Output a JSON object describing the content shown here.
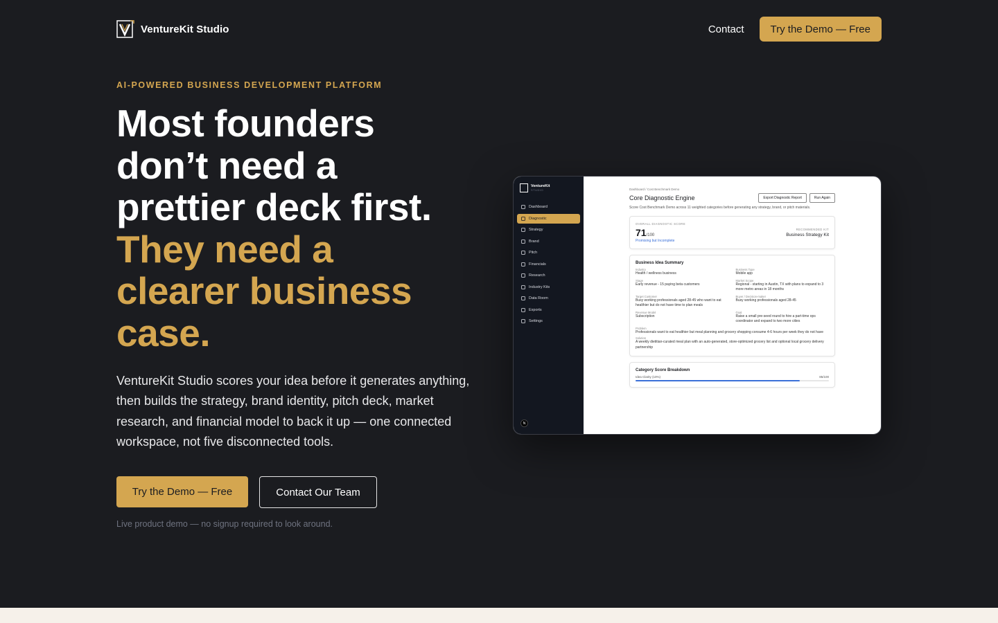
{
  "nav": {
    "brand": "VentureKit Studio",
    "contact": "Contact",
    "cta": "Try the Demo — Free"
  },
  "hero": {
    "eyebrow": "AI-POWERED BUSINESS DEVELOPMENT PLATFORM",
    "headline_white": [
      "Most founders",
      "don’t need a",
      "prettier deck first."
    ],
    "headline_gold": [
      "They need a",
      "clearer business",
      "case."
    ],
    "sub": "VentureKit Studio scores your idea before it generates anything, then builds the strategy, brand identity, pitch deck, market research, and financial model to back it up — one connected workspace, not five disconnected tools.",
    "cta_primary": "Try the Demo — Free",
    "cta_secondary": "Contact Our Team",
    "note": "Live product demo — no signup required to look around."
  },
  "mockup": {
    "brand": "VentureKit",
    "brand_sub": "STUDIO",
    "sidebar": [
      "Dashboard",
      "Diagnostic",
      "Strategy",
      "Brand",
      "Pitch",
      "Financials",
      "Research",
      "Industry Kits",
      "Data Room",
      "Exports",
      "Settings"
    ],
    "active_item": "Diagnostic",
    "avatar": "N",
    "breadcrumb": "Dashboard / Cost Benchmark Demo",
    "title": "Core Diagnostic Engine",
    "btn_export": "Export Diagnostic Report",
    "btn_run": "Run Again",
    "desc": "Score Cost Benchmark Demo across 11 weighted categories before generating any strategy, brand, or pitch materials.",
    "score_label": "OVERALL DIAGNOSTIC SCORE",
    "score": "71",
    "score_max": "/100",
    "score_status": "Promising but Incomplete",
    "kit_label": "RECOMMENDED KIT",
    "kit_name": "Business Strategy Kit",
    "summary_title": "Business Idea Summary",
    "fields": [
      {
        "label": "Industry",
        "value": "Health / wellness business"
      },
      {
        "label": "Business Type",
        "value": "Mobile app"
      },
      {
        "label": "Stage",
        "value": "Early revenue - 15 paying beta customers"
      },
      {
        "label": "Market Scope",
        "value": "Regional - starting in Austin, TX with plans to expand to 3 more metro areas in 18 months"
      },
      {
        "label": "Target Customer",
        "value": "Busy working professionals aged 28-45 who want to eat healthier but do not have time to plan meals"
      },
      {
        "label": "Buyer / Decision-maker",
        "value": "Busy working professionals aged 28-45"
      },
      {
        "label": "Revenue Model",
        "value": "Subscription"
      },
      {
        "label": "Goal",
        "value": "Raise a small pre-seed round to hire a part-time ops coordinator and expand to two more cities"
      }
    ],
    "problem_label": "Problem",
    "problem": "Professionals want to eat healthier but meal planning and grocery shopping consume 4-6 hours per week they do not have",
    "solution_label": "Solution",
    "solution": "A weekly dietitian-curated meal plan with an auto-generated, store-optimized grocery list and optional local grocery delivery partnership",
    "breakdown_title": "Category Score Breakdown",
    "breakdown_item": "Idea Clarity (10%)",
    "breakdown_score": "85/100",
    "breakdown_fraction": 0.85
  },
  "colors": {
    "background": "#1b1c20",
    "accent_gold": "#d4a650",
    "band": "#f6f1ea",
    "status_blue": "#3a6fd8"
  }
}
